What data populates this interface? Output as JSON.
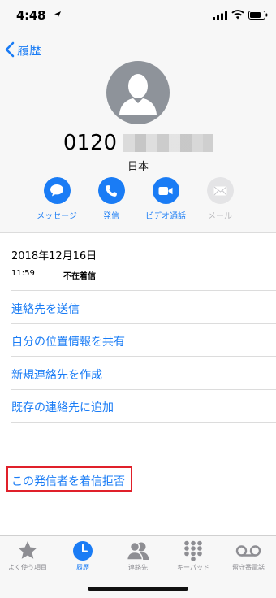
{
  "status_bar": {
    "time": "4:48"
  },
  "nav": {
    "back_label": "履歴"
  },
  "contact": {
    "number_prefix": "0120",
    "country": "日本"
  },
  "actions": [
    {
      "label": "メッセージ",
      "icon": "message-icon",
      "enabled": true
    },
    {
      "label": "発信",
      "icon": "phone-icon",
      "enabled": true
    },
    {
      "label": "ビデオ通話",
      "icon": "video-icon",
      "enabled": true
    },
    {
      "label": "メール",
      "icon": "mail-icon",
      "enabled": false
    }
  ],
  "call_log": {
    "date": "2018年12月16日",
    "time": "11:59",
    "type": "不在着信"
  },
  "menu": {
    "send_contact": "連絡先を送信",
    "share_location": "自分の位置情報を共有",
    "create_contact": "新規連絡先を作成",
    "add_existing": "既存の連絡先に追加",
    "block_caller": "この発信者を着信拒否"
  },
  "tabs": [
    {
      "label": "よく使う項目",
      "icon": "star-icon",
      "active": false
    },
    {
      "label": "履歴",
      "icon": "clock-icon",
      "active": true
    },
    {
      "label": "連絡先",
      "icon": "contacts-icon",
      "active": false
    },
    {
      "label": "キーパッド",
      "icon": "keypad-icon",
      "active": false
    },
    {
      "label": "留守番電話",
      "icon": "voicemail-icon",
      "active": false
    }
  ],
  "colors": {
    "accent": "#1a7cf5",
    "highlight": "#e0202a",
    "inactive": "#8e8e93"
  }
}
